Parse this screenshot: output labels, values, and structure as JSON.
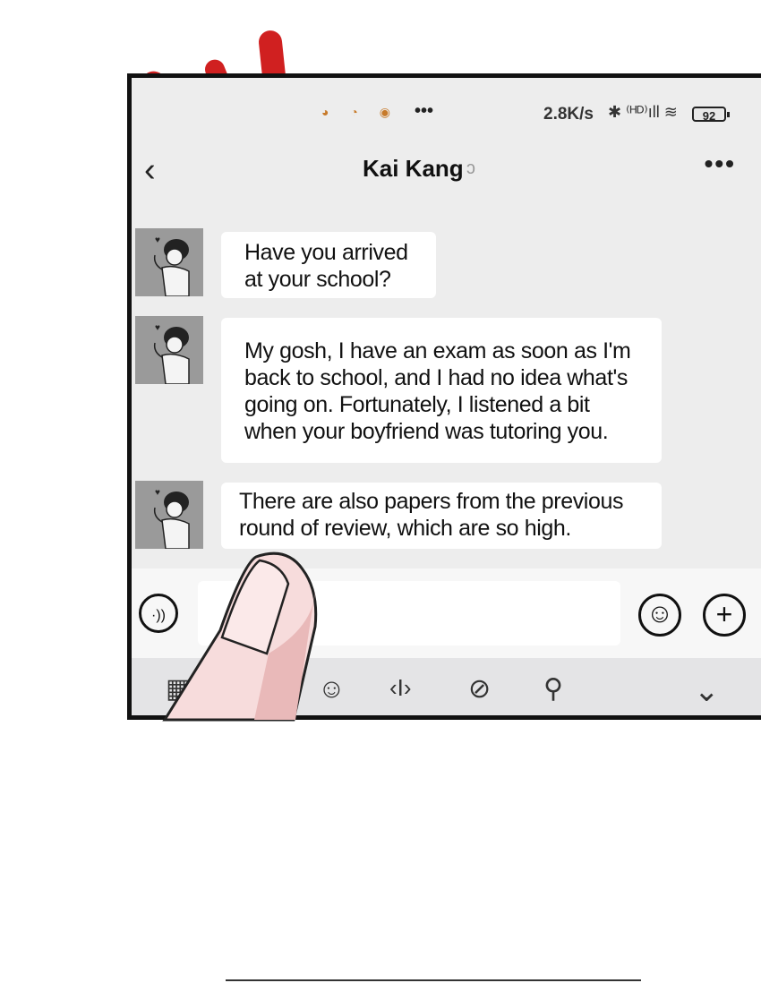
{
  "status_bar": {
    "app_icons": "◕ ◔ ◉",
    "more": "•••",
    "network_speed": "2.8K/s",
    "signal": "✱ ⁽ᴴᴰ⁾ıll ≋",
    "battery": "92"
  },
  "header": {
    "back_icon": "chevron-left",
    "back_glyph": "‹",
    "title": "Kai Kang",
    "ear_glyph": "ↄ",
    "more_glyph": "•••"
  },
  "messages": [
    {
      "sender": "Kai Kang",
      "text": "Have you arrived\nat your school?"
    },
    {
      "sender": "Kai Kang",
      "text": "My gosh, I have an exam as soon as I'm\nback to school, and I had no idea what's\ngoing on. Fortunately, I listened a bit\nwhen your boyfriend was tutoring you."
    },
    {
      "sender": "Kai Kang",
      "text": "There are also papers from the previous\nround of review, which are so high."
    }
  ],
  "input_bar": {
    "voice_glyph": "·))",
    "emoji_glyph": "☺",
    "plus_glyph": "+"
  },
  "toolbar": {
    "grid_glyph": "▦",
    "emoji_glyph": "☺",
    "cursor_glyph": "‹I›",
    "link_glyph": "⊘",
    "search_glyph": "⚲",
    "collapse_glyph": "⌄"
  },
  "colors": {
    "accent_red": "#d02020",
    "phone_bg": "#ededed",
    "bubble_bg": "#ffffff",
    "toolbar_bg": "#e4e4e6"
  }
}
